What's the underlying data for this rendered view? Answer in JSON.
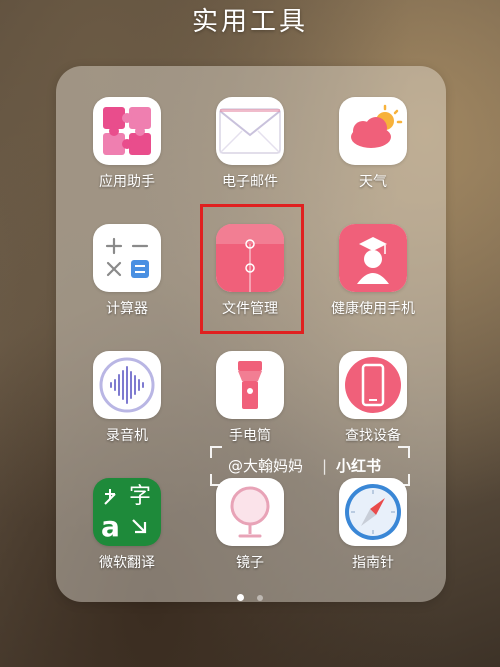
{
  "folder": {
    "title": "实用工具"
  },
  "apps": [
    {
      "label": "应用助手",
      "icon": "puzzle-icon"
    },
    {
      "label": "电子邮件",
      "icon": "envelope-icon"
    },
    {
      "label": "天气",
      "icon": "weather-icon"
    },
    {
      "label": "计算器",
      "icon": "calculator-icon"
    },
    {
      "label": "文件管理",
      "icon": "folder-icon"
    },
    {
      "label": "健康使用手机",
      "icon": "health-user-icon"
    },
    {
      "label": "录音机",
      "icon": "waveform-icon"
    },
    {
      "label": "手电筒",
      "icon": "flashlight-icon"
    },
    {
      "label": "查找设备",
      "icon": "find-device-icon"
    },
    {
      "label": "微软翻译",
      "icon": "translate-icon",
      "icon_text": "字"
    },
    {
      "label": "镜子",
      "icon": "mirror-icon"
    },
    {
      "label": "指南针",
      "icon": "compass-icon"
    }
  ],
  "watermark": {
    "handle": "@大翰妈妈",
    "separator": "|",
    "brand": "小红书"
  },
  "pagination": {
    "pages": 2,
    "active_page": 1
  },
  "colors": {
    "accent_pink": "#f0607a",
    "highlight_red": "#e02020",
    "translate_green": "#1e8a3a",
    "compass_blue": "#3a87d6"
  }
}
